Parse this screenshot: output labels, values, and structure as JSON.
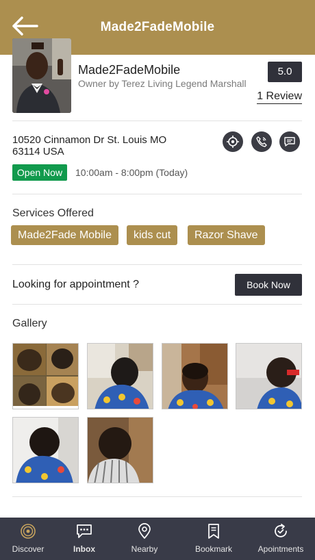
{
  "header": {
    "title": "Made2FadeMobile",
    "back_icon": "arrow-left-icon",
    "background": "#ac8f4f"
  },
  "profile": {
    "name": "Made2FadeMobile",
    "owner": "Owner by Terez Living Legend Marshall",
    "rating": "5.0",
    "reviews_label": "1 Review"
  },
  "location": {
    "address": "10520 Cinnamon Dr St. Louis MO 63114 USA",
    "status": "Open Now",
    "status_color": "#119a4d",
    "hours": "10:00am - 8:00pm (Today)",
    "actions": [
      "location-target-icon",
      "phone-icon",
      "message-icon"
    ]
  },
  "services": {
    "title": "Services Offered",
    "items": [
      "Made2Fade Mobile",
      "kids cut",
      "Razor Shave"
    ]
  },
  "appointment": {
    "prompt": "Looking for appointment ?",
    "button": "Book Now"
  },
  "gallery": {
    "title": "Gallery",
    "count": 6
  },
  "tabbar": {
    "background": "#393b48",
    "items": [
      {
        "label": "Discover",
        "icon": "discover-icon"
      },
      {
        "label": "Inbox",
        "icon": "chat-icon"
      },
      {
        "label": "Nearby",
        "icon": "map-pin-icon"
      },
      {
        "label": "Bookmark",
        "icon": "bookmark-icon"
      },
      {
        "label": "Apointments",
        "icon": "refresh-check-icon"
      }
    ]
  }
}
